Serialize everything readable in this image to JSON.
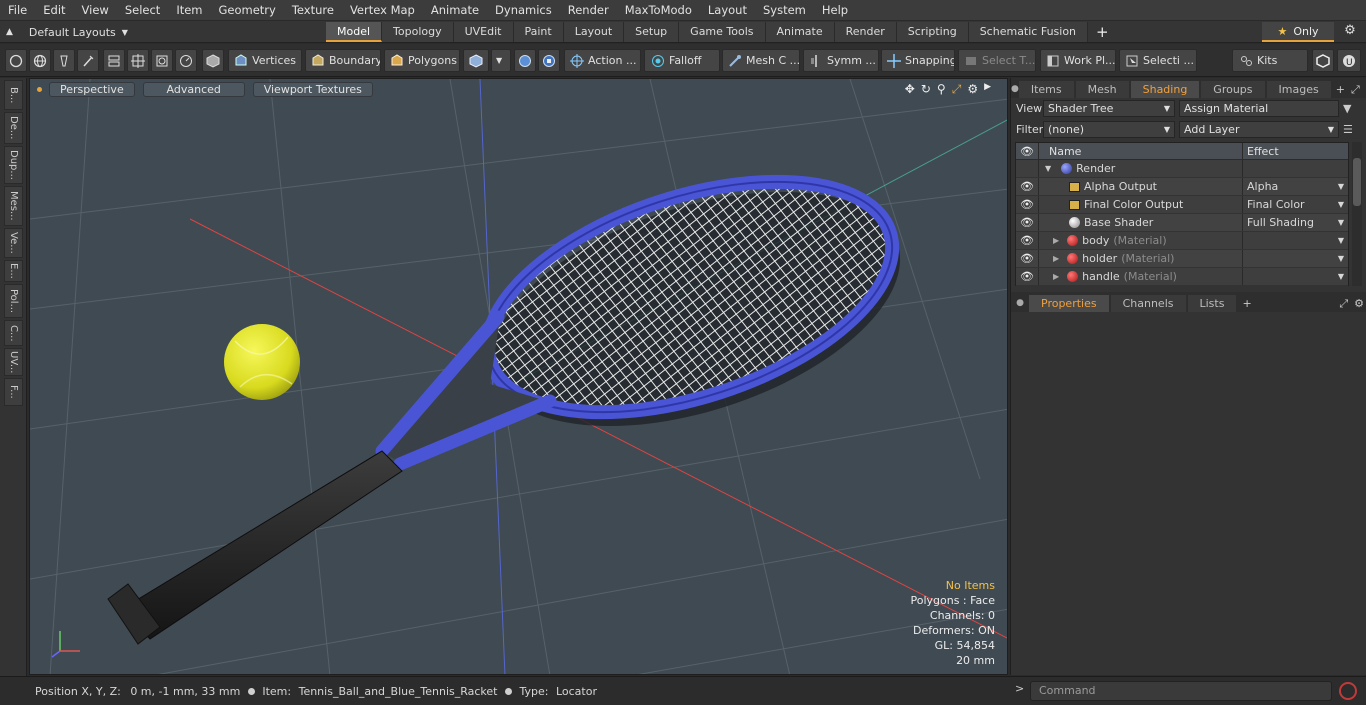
{
  "menu": [
    "File",
    "Edit",
    "View",
    "Select",
    "Item",
    "Geometry",
    "Texture",
    "Vertex Map",
    "Animate",
    "Dynamics",
    "Render",
    "MaxToModo",
    "Layout",
    "System",
    "Help"
  ],
  "layout": {
    "selector": "Default Layouts",
    "tabs": [
      "Model",
      "Topology",
      "UVEdit",
      "Paint",
      "Layout",
      "Setup",
      "Game Tools",
      "Animate",
      "Render",
      "Scripting",
      "Schematic Fusion"
    ],
    "active_tab": "Model",
    "only_label": "Only"
  },
  "toolbar": {
    "vertices": "Vertices",
    "boundary": "Boundary",
    "polygons": "Polygons",
    "action": "Action ...",
    "falloff": "Falloff",
    "mesh": "Mesh C ...",
    "symm": "Symm ...",
    "snapping": "Snapping",
    "select_t": "Select T...",
    "workpl": "Work Pl...",
    "selecti": "Selecti ...",
    "kits": "Kits"
  },
  "left_tabs": [
    "B...",
    "De...",
    "Dup...",
    "Mes...",
    "Ve...",
    "E...",
    "Pol...",
    "C...",
    "UV...",
    "F..."
  ],
  "viewport": {
    "mode": "Perspective",
    "shading": "Advanced",
    "textures": "Viewport Textures",
    "stats": {
      "items": "No Items",
      "polygons": "Polygons : Face",
      "channels": "Channels: 0",
      "deformers": "Deformers: ON",
      "gl": "GL: 54,854",
      "scale": "20 mm"
    }
  },
  "right_panel": {
    "tabs": [
      "Items",
      "Mesh ...",
      "Shading",
      "Groups",
      "Images"
    ],
    "active_tab": "Shading",
    "view_label": "View",
    "view_value": "Shader Tree",
    "assign_material": "Assign Material",
    "filter_label": "Filter",
    "filter_value": "(none)",
    "add_layer": "Add Layer",
    "tree_headers": {
      "name": "Name",
      "effect": "Effect"
    },
    "tree_rows": [
      {
        "name": "Render",
        "sub": "",
        "effect": "",
        "kind": "render"
      },
      {
        "name": "Alpha Output",
        "sub": "",
        "effect": "Alpha",
        "kind": "output"
      },
      {
        "name": "Final Color Output",
        "sub": "",
        "effect": "Final Color",
        "kind": "output"
      },
      {
        "name": "Base Shader",
        "sub": "",
        "effect": "Full Shading",
        "kind": "shader"
      },
      {
        "name": "body",
        "sub": "(Material)",
        "effect": "",
        "kind": "material"
      },
      {
        "name": "holder",
        "sub": "(Material)",
        "effect": "",
        "kind": "material"
      },
      {
        "name": "handle",
        "sub": "(Material)",
        "effect": "",
        "kind": "material"
      }
    ],
    "lower_tabs": [
      "Properties",
      "Channels",
      "Lists"
    ],
    "lower_active": "Properties"
  },
  "status": {
    "position_label": "Position X, Y, Z:",
    "position_value": "0 m, -1 mm, 33 mm",
    "item_label": "Item:",
    "item_value": "Tennis_Ball_and_Blue_Tennis_Racket",
    "type_label": "Type:",
    "type_value": "Locator",
    "command_placeholder": "Command"
  },
  "colors": {
    "accent": "#e8a23a",
    "racket": "#4a55d6",
    "ball": "#e4e62e"
  }
}
